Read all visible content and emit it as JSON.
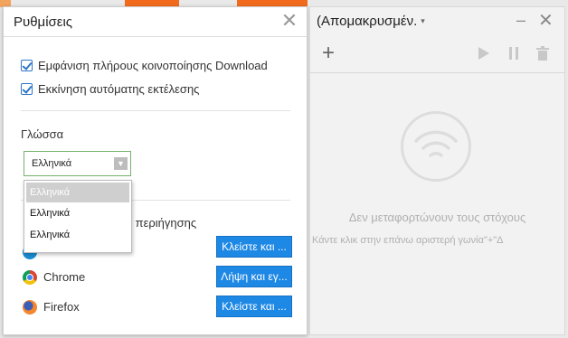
{
  "settings": {
    "title": "Ρυθμίσεις",
    "close_glyph": "✕",
    "options": [
      {
        "label": "Εμφάνιση πλήρους κοινοποίησης Download",
        "checked": true
      },
      {
        "label": "Εκκίνηση αυτόματης εκτέλεσης",
        "checked": true
      }
    ],
    "language_label": "Γλώσσα",
    "language_select": {
      "value": "Ελληνικά",
      "options": [
        "Ελληνικά",
        "Ελληνικά",
        "Ελληνικά"
      ]
    },
    "browser_section_partial": "μα περιήγησης",
    "browsers": [
      {
        "name": "",
        "button": "Κλείστε και ..."
      },
      {
        "name": "Chrome",
        "button": "Λήψη και εγ..."
      },
      {
        "name": "Firefox",
        "button": "Κλείστε και ..."
      }
    ]
  },
  "downloads": {
    "title": "(Απομακρυσμέν.",
    "caret_glyph": "▾",
    "minimize_glyph": "–",
    "close_glyph": "✕",
    "add_glyph": "+",
    "empty_title": "Δεν μεταφορτώνουν τους στόχους",
    "empty_subtitle": "Κάντε κλικ στην επάνω αριστερή γωνία\"+\"Δ"
  },
  "colors": {
    "accent_blue": "#1e88e5",
    "check_blue": "#2e75c8",
    "select_border_green": "#73b36a",
    "bg_orange": "#f26b1d"
  }
}
